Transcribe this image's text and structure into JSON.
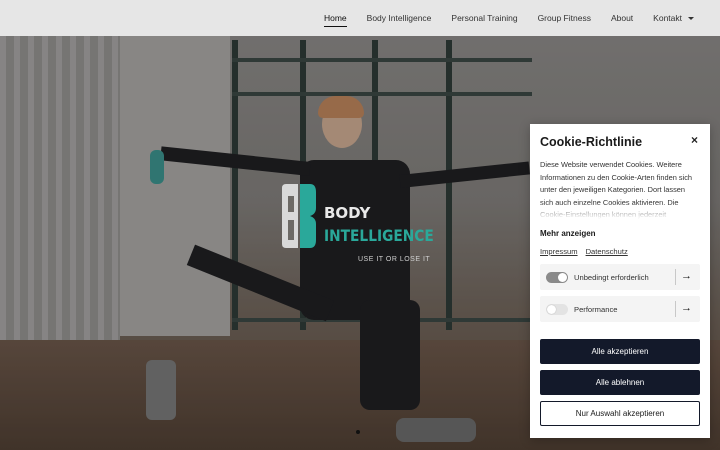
{
  "nav": {
    "items": [
      "Home",
      "Body Intelligence",
      "Personal Training",
      "Group Fitness",
      "About",
      "Kontakt"
    ],
    "active": "Home"
  },
  "logo": {
    "word1": "BODY",
    "word2": "INTELLIGENCE",
    "tagline": "USE IT OR LOSE IT"
  },
  "cookie": {
    "title": "Cookie-Richtlinie",
    "close": "×",
    "text": "Diese Website verwendet Cookies. Weitere Informationen zu den Cookie-Arten finden sich unter den jeweiligen Kategorien. Dort lassen sich auch einzelne Cookies aktivieren. Die Cookie-Einstellungen können jederzeit",
    "more": "Mehr anzeigen",
    "links": {
      "impressum": "Impressum",
      "datenschutz": "Datenschutz"
    },
    "categories": [
      {
        "label": "Unbedingt erforderlich",
        "enabled": true
      },
      {
        "label": "Performance",
        "enabled": false
      }
    ],
    "buttons": {
      "accept_all": "Alle akzeptieren",
      "reject_all": "Alle ablehnen",
      "accept_selection": "Nur Auswahl akzeptieren"
    }
  },
  "colors": {
    "accent": "#2aa89a",
    "button_dark": "#13192a"
  },
  "slider": {
    "dots": 3,
    "active": 1
  }
}
